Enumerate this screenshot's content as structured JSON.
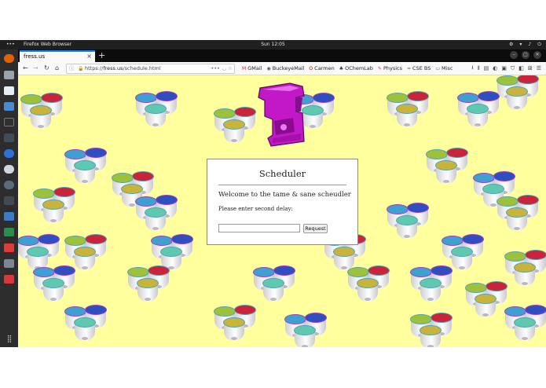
{
  "top_bar": {
    "activities": "•••",
    "app_name": "Firefox Web Browser",
    "clock": "Sun 12:05"
  },
  "tab": {
    "title": "fress.us",
    "close": "×",
    "new_tab": "+"
  },
  "navigation": {
    "url_domain": "fress.us",
    "url_prefix": "https://",
    "url_path": "/schedule.html",
    "url_more": "•••"
  },
  "bookmarks": [
    {
      "icon": "M",
      "label": "GMail",
      "color": "#d93025"
    },
    {
      "icon": "◉",
      "label": "BuckeyeMail",
      "color": "#555555"
    },
    {
      "icon": "O",
      "label": "Carmen",
      "color": "#bb0000"
    },
    {
      "icon": "♣",
      "label": "OChemLab",
      "color": "#333333"
    },
    {
      "icon": "✎",
      "label": "Physics",
      "color": "#d93025"
    },
    {
      "icon": "≈",
      "label": "CSE BS",
      "color": "#7a4a00"
    },
    {
      "icon": "▭",
      "label": "Misc",
      "color": "#555555"
    }
  ],
  "dialog": {
    "title": "Scheduler",
    "welcome": "Welcome to the tame & sane scheudler",
    "prompt": "Please enter second delay:",
    "input_value": "",
    "button_label": "Request"
  },
  "colors": {
    "page_background": "#ffff9e",
    "machine": "#c218c8",
    "tab_accent": "#0a84ff"
  }
}
